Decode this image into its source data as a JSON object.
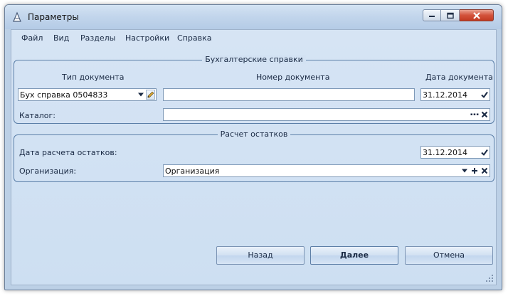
{
  "window": {
    "title": "Параметры"
  },
  "menu": [
    "Файл",
    "Вид",
    "Разделы",
    "Настройки",
    "Справка"
  ],
  "accounting_group": {
    "legend": "Бухгалтерские справки",
    "doc_type_label": "Тип документа",
    "doc_number_label": "Номер документа",
    "doc_date_label": "Дата документа",
    "doc_type_value": "Бух справка 0504833",
    "doc_number_value": "",
    "doc_date_value": "31.12.2014",
    "catalog_label": "Каталог:",
    "catalog_value": ""
  },
  "balance_group": {
    "legend": "Расчет остатков",
    "calc_date_label": "Дата расчета остатков:",
    "calc_date_value": "31.12.2014",
    "org_label": "Организация:",
    "org_value": "Организация"
  },
  "buttons": {
    "back": "Назад",
    "next": "Далее",
    "cancel": "Отмена"
  },
  "icons": [
    "app-icon",
    "minimize-icon",
    "maximize-icon",
    "close-icon",
    "dropdown-icon",
    "edit-icon",
    "checkbox-icon",
    "ellipsis-icon",
    "clear-icon",
    "plus-icon",
    "resize-grip-icon"
  ]
}
